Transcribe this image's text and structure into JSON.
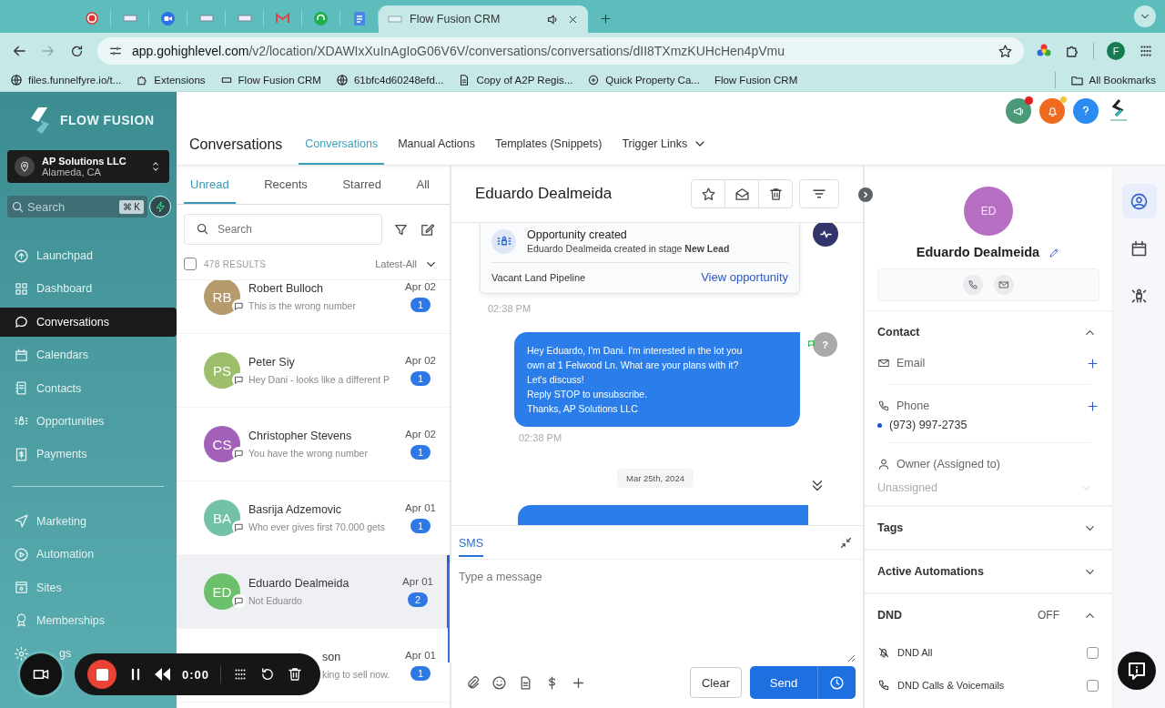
{
  "browser": {
    "tabs": [
      {
        "kind": "record",
        "selected": false
      },
      {
        "kind": "page",
        "selected": false
      },
      {
        "kind": "zoom",
        "selected": false
      },
      {
        "kind": "page",
        "selected": false
      },
      {
        "kind": "page",
        "selected": false
      },
      {
        "kind": "mail",
        "selected": false
      },
      {
        "kind": "support",
        "selected": false
      },
      {
        "kind": "doc",
        "selected": false
      },
      {
        "kind": "page",
        "selected": true,
        "title": "Flow Fusion CRM"
      }
    ],
    "address": {
      "host": "app.gohighlevel.com",
      "path": "/v2/location/XDAWIxXuInAgIoG06V6V/conversations/conversations/dII8TXmzKUHcHen4pVmu"
    },
    "profile_initial": "F",
    "bookmarks": [
      {
        "label": "files.funnelfyre.io/t...",
        "kind": "globe"
      },
      {
        "label": "Extensions",
        "kind": "puzzle"
      },
      {
        "label": "Flow Fusion CRM",
        "kind": "page"
      },
      {
        "label": "61bfc4d60248efd...",
        "kind": "globe"
      },
      {
        "label": "Copy of A2P Regis...",
        "kind": "doc"
      },
      {
        "label": "Quick Property Ca...",
        "kind": "app"
      },
      {
        "label": "Flow Fusion CRM",
        "kind": "none"
      }
    ],
    "all_bookmarks": "All Bookmarks"
  },
  "sidebar": {
    "logo": "FLOW FUSION",
    "account": {
      "name": "AP Solutions LLC",
      "location": "Alameda, CA"
    },
    "search": {
      "placeholder": "Search",
      "shortcut": "⌘ K"
    },
    "items": [
      {
        "label": "Launchpad",
        "selected": false
      },
      {
        "label": "Dashboard",
        "selected": false
      },
      {
        "label": "Conversations",
        "selected": true
      },
      {
        "label": "Calendars",
        "selected": false
      },
      {
        "label": "Contacts",
        "selected": false
      },
      {
        "label": "Opportunities",
        "selected": false
      },
      {
        "label": "Payments",
        "selected": false
      }
    ],
    "items_2": [
      {
        "label": "Marketing",
        "selected": false
      },
      {
        "label": "Automation",
        "selected": false
      },
      {
        "label": "Sites",
        "selected": false
      },
      {
        "label": "Memberships",
        "selected": false
      }
    ],
    "covered_item": {
      "label": "gs"
    }
  },
  "header": {
    "title": "Conversations",
    "tabs": [
      {
        "label": "Conversations",
        "selected": true,
        "dropdown": false
      },
      {
        "label": "Manual Actions",
        "selected": false,
        "dropdown": false
      },
      {
        "label": "Templates (Snippets)",
        "selected": false,
        "dropdown": false
      },
      {
        "label": "Trigger Links",
        "selected": false,
        "dropdown": true
      }
    ]
  },
  "list": {
    "tabs": [
      {
        "label": "Unread",
        "selected": true
      },
      {
        "label": "Recents",
        "selected": false
      },
      {
        "label": "Starred",
        "selected": false
      },
      {
        "label": "All",
        "selected": false
      }
    ],
    "search": {
      "placeholder": "Search"
    },
    "select_all": {
      "checked": false
    },
    "results": "478 RESULTS",
    "sort": "Latest-All",
    "rows": [
      {
        "initials": "RB",
        "color": "#b59a6b",
        "name": "Robert Bulloch",
        "preview": "This is the wrong number",
        "date": "Apr 02",
        "count": "1",
        "selected": false
      },
      {
        "initials": "PS",
        "color": "#9dbf6b",
        "name": "Peter Siy",
        "preview": "Hey Dani - looks like a different P",
        "date": "Apr 02",
        "count": "1",
        "selected": false
      },
      {
        "initials": "CS",
        "color": "#a260b8",
        "name": "Christopher Stevens",
        "preview": "You have the wrong number",
        "date": "Apr 02",
        "count": "1",
        "selected": false
      },
      {
        "initials": "BA",
        "color": "#73c2a6",
        "name": "Basrija Adzemovic",
        "preview": "Who ever gives first 70.000 gets",
        "date": "Apr 01",
        "count": "1",
        "selected": false
      },
      {
        "initials": "ED",
        "color": "#6cbf6b",
        "name": "Eduardo Dealmeida",
        "preview": "Not Eduardo",
        "date": "Apr 01",
        "count": "2",
        "selected": true
      },
      {
        "name": "son",
        "preview": "king to sell now.",
        "date": "Apr 01",
        "count": "1",
        "selected": false
      }
    ]
  },
  "chat": {
    "name": "Eduardo Dealmeida",
    "events": [
      {
        "kind": "opportunity",
        "title": "Opportunity created",
        "text": "Eduardo Dealmeida created in stage **New Lead**",
        "pipeline": "Vacant Land Pipeline",
        "link": "View opportunity",
        "time": "02:38 PM"
      },
      {
        "kind": "outbound",
        "text": "Hey Eduardo, I'm Dani. I'm interested in the lot you\nown at 1 Felwood Ln. What are your plans with it?\nLet's discuss!\nReply STOP to unsubscribe.\nThanks, AP Solutions LLC",
        "time": "02:38 PM",
        "avatar": "?"
      },
      {
        "kind": "date",
        "text": "Mar 25th, 2024"
      },
      {
        "kind": "outbound_cut"
      }
    ]
  },
  "composer": {
    "tabs": [
      {
        "label": "SMS",
        "selected": true
      }
    ],
    "placeholder": "Type a message",
    "clear": "Clear",
    "send": "Send"
  },
  "contact": {
    "initials": "ED",
    "name": "Eduardo Dealmeida",
    "details": {
      "title": "Contact",
      "expanded": true,
      "email_label": "Email",
      "phone_label": "Phone",
      "phone": "(973) 997-2735",
      "owner_label": "Owner (Assigned to)",
      "owner_placeholder": "Unassigned"
    },
    "sections": [
      {
        "title": "Tags",
        "expanded": false
      },
      {
        "title": "Active Automations",
        "expanded": false
      }
    ],
    "dnd": {
      "title": "DND",
      "status": "OFF",
      "expanded": true,
      "options": [
        {
          "label": "DND All",
          "checked": false
        },
        {
          "label": "DND Calls & Voicemails",
          "checked": false
        }
      ]
    }
  },
  "rail": [
    {
      "selected": true
    },
    {
      "selected": false
    },
    {
      "selected": false
    }
  ],
  "recorder": {
    "time": "0:00"
  }
}
